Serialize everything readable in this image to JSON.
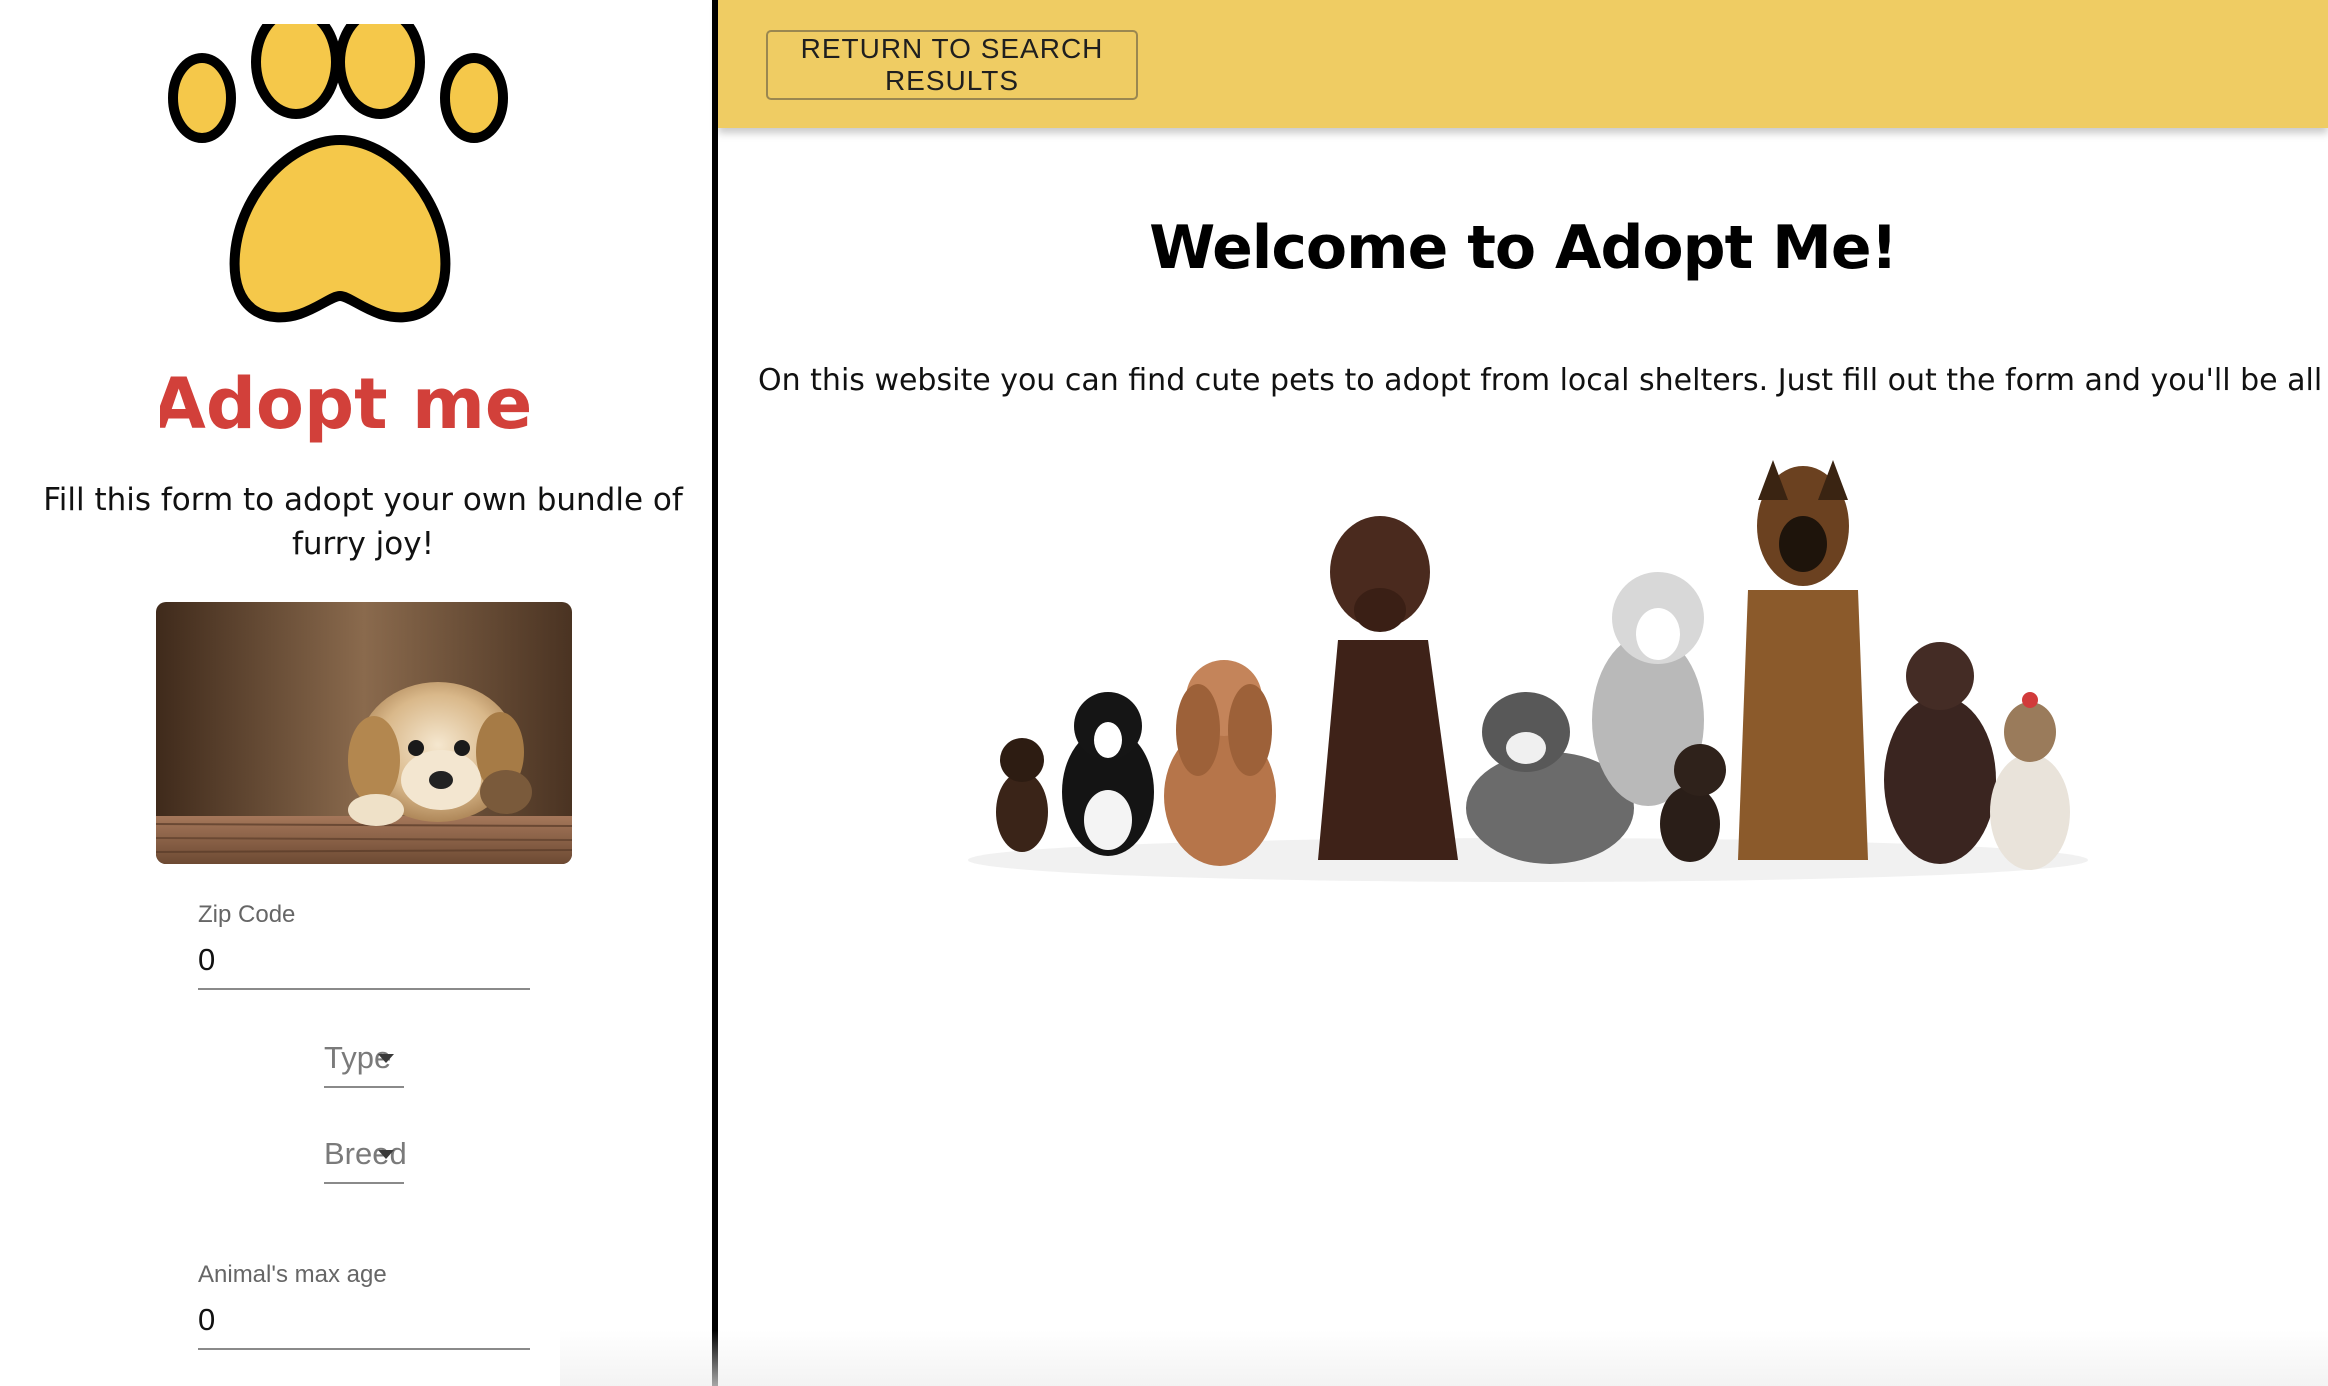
{
  "sidebar": {
    "logo_text": "Adopt me",
    "tagline": "Fill this form to adopt your own bundle of furry joy!",
    "form": {
      "zip": {
        "label": "Zip Code",
        "value": "0"
      },
      "type": {
        "label": "Type"
      },
      "breed": {
        "label": "Breed"
      },
      "max_age": {
        "label": "Animal's max age",
        "value": "0"
      }
    }
  },
  "topbar": {
    "return_label": "RETURN TO SEARCH RESULTS"
  },
  "main": {
    "title": "Welcome to Adopt Me!",
    "intro": "On this website you can find cute pets to adopt from local shelters. Just fill out the form and you'll be all set!"
  },
  "colors": {
    "accent": "#efcc63",
    "paw_fill": "#f5c84a",
    "logo_text": "#d2403a"
  },
  "icons": [
    "paw-print-icon",
    "dropdown-arrow-icon"
  ]
}
